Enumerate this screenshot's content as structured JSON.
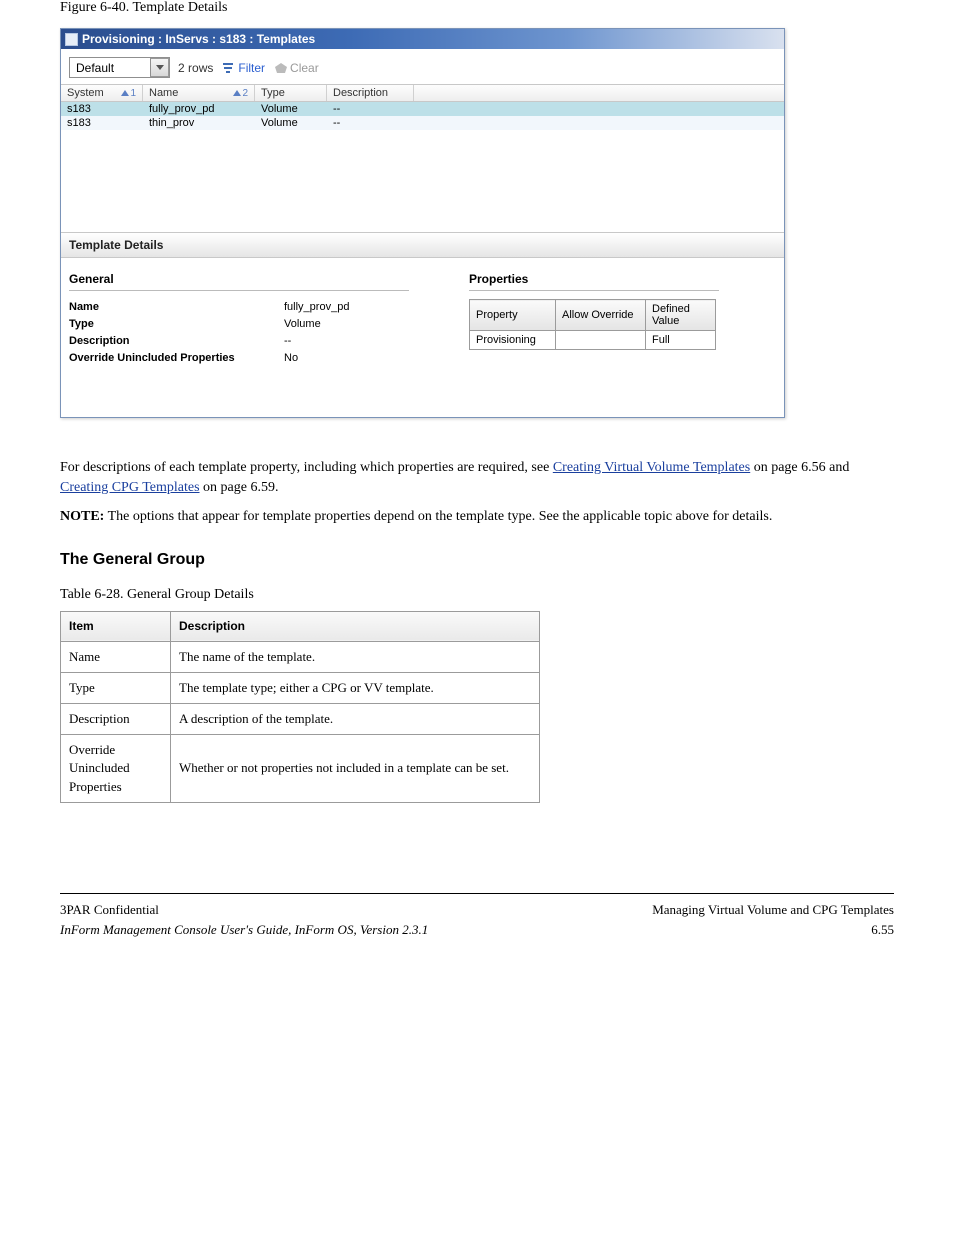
{
  "figure_label": "Figure 6-40.  Template Details",
  "titlebar": "Provisioning : InServs : s183 : Templates",
  "toolbar": {
    "dropdown_value": "Default",
    "rows_label": "2 rows",
    "filter_label": "Filter",
    "clear_label": "Clear"
  },
  "grid": {
    "headers": {
      "system": "System",
      "name": "Name",
      "type": "Type",
      "description": "Description",
      "sort1": "1",
      "sort2": "2"
    },
    "rows": [
      {
        "system": "s183",
        "name": "fully_prov_pd",
        "type": "Volume",
        "description": "--",
        "selected": true
      },
      {
        "system": "s183",
        "name": "thin_prov",
        "type": "Volume",
        "description": "--",
        "alt": true
      }
    ]
  },
  "template_details_header": "Template Details",
  "general": {
    "title": "General",
    "rows": {
      "name_k": "Name",
      "name_v": "fully_prov_pd",
      "type_k": "Type",
      "type_v": "Volume",
      "desc_k": "Description",
      "desc_v": "--",
      "over_k": "Override Unincluded Properties",
      "over_v": "No"
    }
  },
  "properties": {
    "title": "Properties",
    "headers": {
      "property": "Property",
      "allow": "Allow Override",
      "defined": "Defined Value"
    },
    "rows": [
      {
        "property": "Provisioning",
        "allow": "",
        "defined": "Full"
      }
    ]
  },
  "doc": {
    "p1_pre": "For descriptions of each template property, including which properties are required, see ",
    "p1_link1": "Creating Virtual Volume Templates",
    "p1_mid": " on page 6.56 and ",
    "p1_link2": "Creating CPG Templates",
    "p1_post": " on page 6.59.",
    "note_label": "NOTE:",
    "note_text": " The options that appear for template properties depend on the template type. See the applicable topic above for details.",
    "section_title": "The General Group",
    "table_label": "Table 6-28.  General Group Details",
    "info_headers": {
      "item": "Item",
      "desc": "Description"
    },
    "info_rows": [
      {
        "item": "Name",
        "desc": "The name of the template."
      },
      {
        "item": "Type",
        "desc": "The template type; either a CPG or VV template."
      },
      {
        "item": "Description",
        "desc": "A description of the template."
      },
      {
        "item": "Override Unincluded Properties",
        "desc": "Whether or not properties not included in a template can be set."
      }
    ]
  },
  "footer": {
    "left": "3PAR Confidential",
    "center": "Managing Virtual Volume and CPG Templates",
    "right_title": "InForm Management Console User's Guide, InForm OS, Version 2.3.1",
    "page": "6.55"
  }
}
